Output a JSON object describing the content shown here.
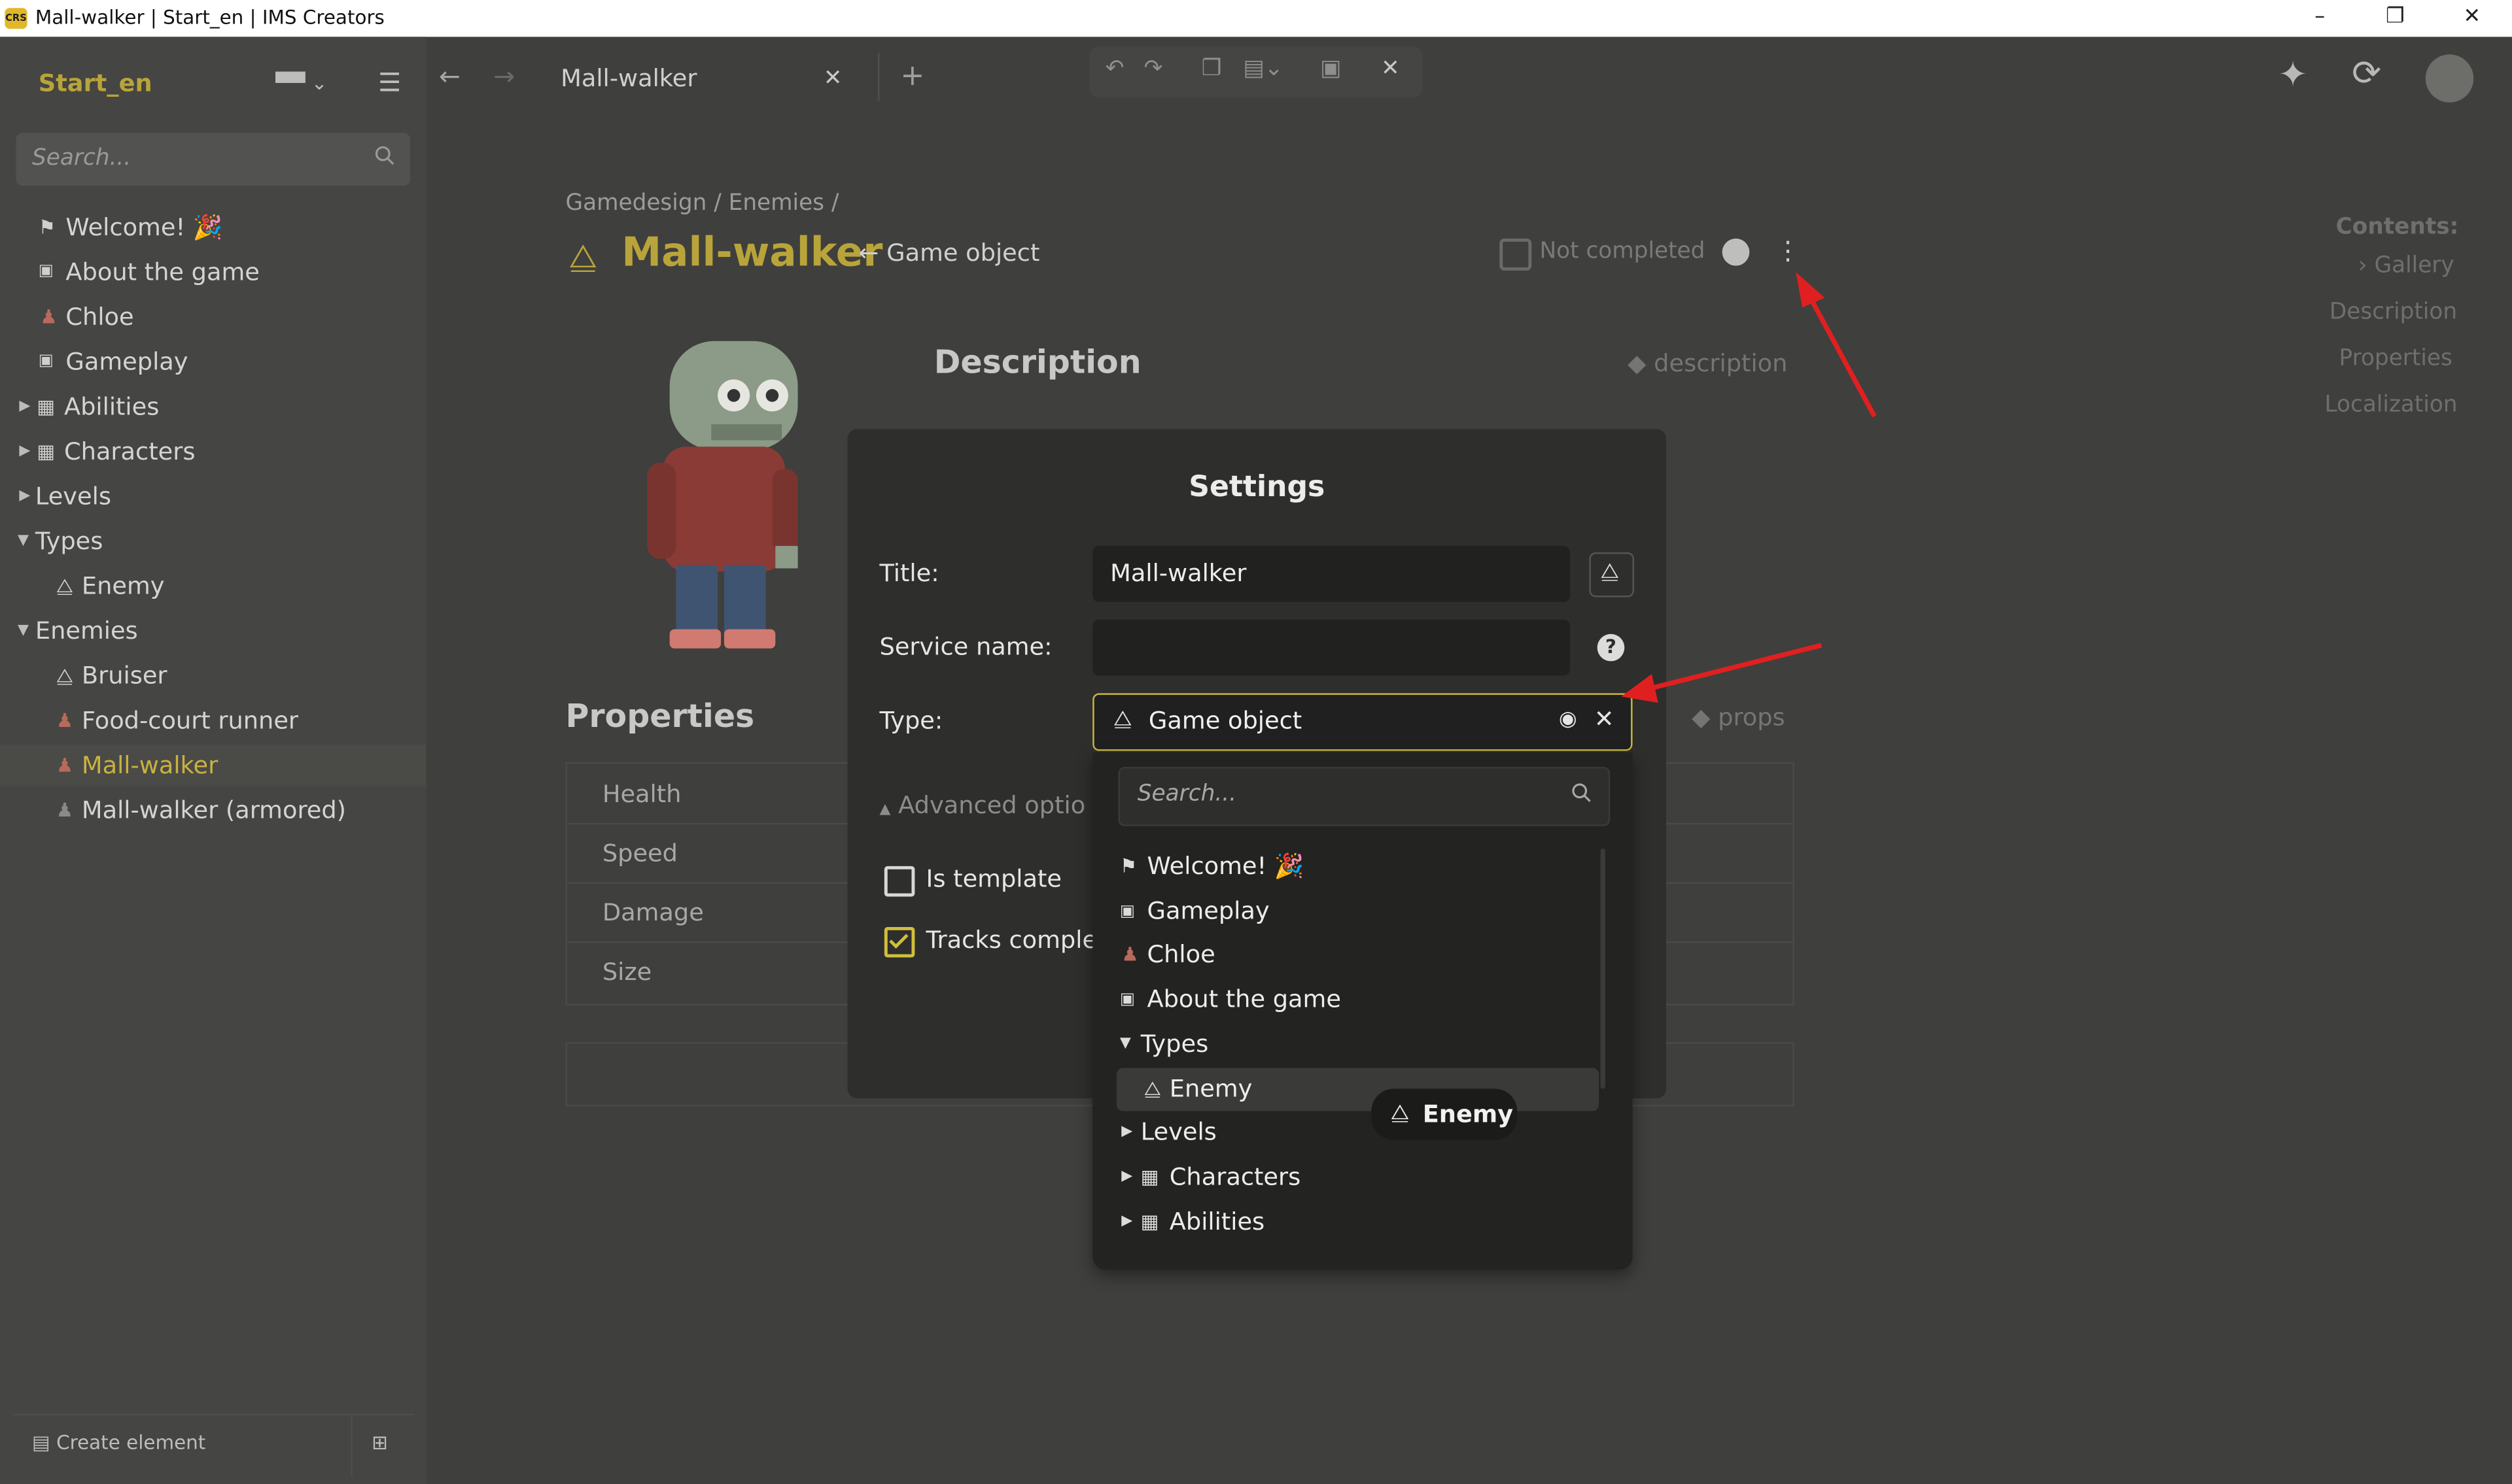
{
  "window": {
    "title": "Mall-walker | Start_en | IMS Creators",
    "app_badge": "CRS",
    "controls": [
      "minimize",
      "restore",
      "close"
    ]
  },
  "sidebar": {
    "project_name": "Start_en",
    "search_placeholder": "Search...",
    "items": [
      {
        "label": "Welcome! 🎉",
        "icon": "flag-icon"
      },
      {
        "label": "About the game",
        "icon": "markdown-icon"
      },
      {
        "label": "Chloe",
        "icon": "character-icon"
      },
      {
        "label": "Gameplay",
        "icon": "markdown-icon"
      },
      {
        "label": "Abilities",
        "icon": "table-icon"
      },
      {
        "label": "Characters",
        "icon": "table-icon"
      },
      {
        "label": "Levels",
        "icon": ""
      },
      {
        "label": "Types",
        "icon": ""
      },
      {
        "label": "Enemy",
        "icon": "shapes-icon"
      },
      {
        "label": "Enemies",
        "icon": ""
      },
      {
        "label": "Bruiser",
        "icon": "shapes-icon"
      },
      {
        "label": "Food-court runner",
        "icon": "character-icon"
      },
      {
        "label": "Mall-walker",
        "icon": "character-icon"
      },
      {
        "label": "Mall-walker (armored)",
        "icon": "character-icon"
      }
    ],
    "create_label": "Create element"
  },
  "tabs": {
    "active_label": "Mall-walker"
  },
  "page": {
    "breadcrumb": "Gamedesign / Enemies /",
    "title": "Mall-walker",
    "type_link": "← Game object",
    "status": "Not completed",
    "description_heading": "Description",
    "description_tag": "description",
    "properties_heading": "Properties",
    "properties_tag": "props",
    "properties": [
      "Health",
      "Speed",
      "Damage",
      "Size"
    ]
  },
  "contents": {
    "title": "Contents:",
    "items": [
      "Gallery",
      "Description",
      "Properties",
      "Localization"
    ]
  },
  "settings_dialog": {
    "heading": "Settings",
    "title_label": "Title:",
    "title_value": "Mall-walker",
    "service_label": "Service name:",
    "service_value": "",
    "type_label": "Type:",
    "type_value": "Game object",
    "advanced_label": "Advanced optio",
    "is_template_label": "Is template",
    "is_template_checked": false,
    "tracks_label": "Tracks complet",
    "tracks_checked": true
  },
  "type_dropdown": {
    "search_placeholder": "Search...",
    "items": [
      {
        "label": "Welcome! 🎉",
        "icon": "flag-icon"
      },
      {
        "label": "Gameplay",
        "icon": "markdown-icon"
      },
      {
        "label": "Chloe",
        "icon": "character-icon"
      },
      {
        "label": "About the game",
        "icon": "markdown-icon"
      },
      {
        "label": "Types",
        "icon": ""
      },
      {
        "label": "Enemy",
        "icon": "shapes-icon"
      },
      {
        "label": "Levels",
        "icon": ""
      },
      {
        "label": "Characters",
        "icon": "table-icon"
      },
      {
        "label": "Abilities",
        "icon": "table-icon"
      }
    ],
    "tooltip": "Enemy"
  },
  "annotations": {
    "arrow_color": "#e02020"
  },
  "colors": {
    "accent": "#b8a43a",
    "background": "#3f3f3d",
    "dialog": "#2e2e2d"
  }
}
